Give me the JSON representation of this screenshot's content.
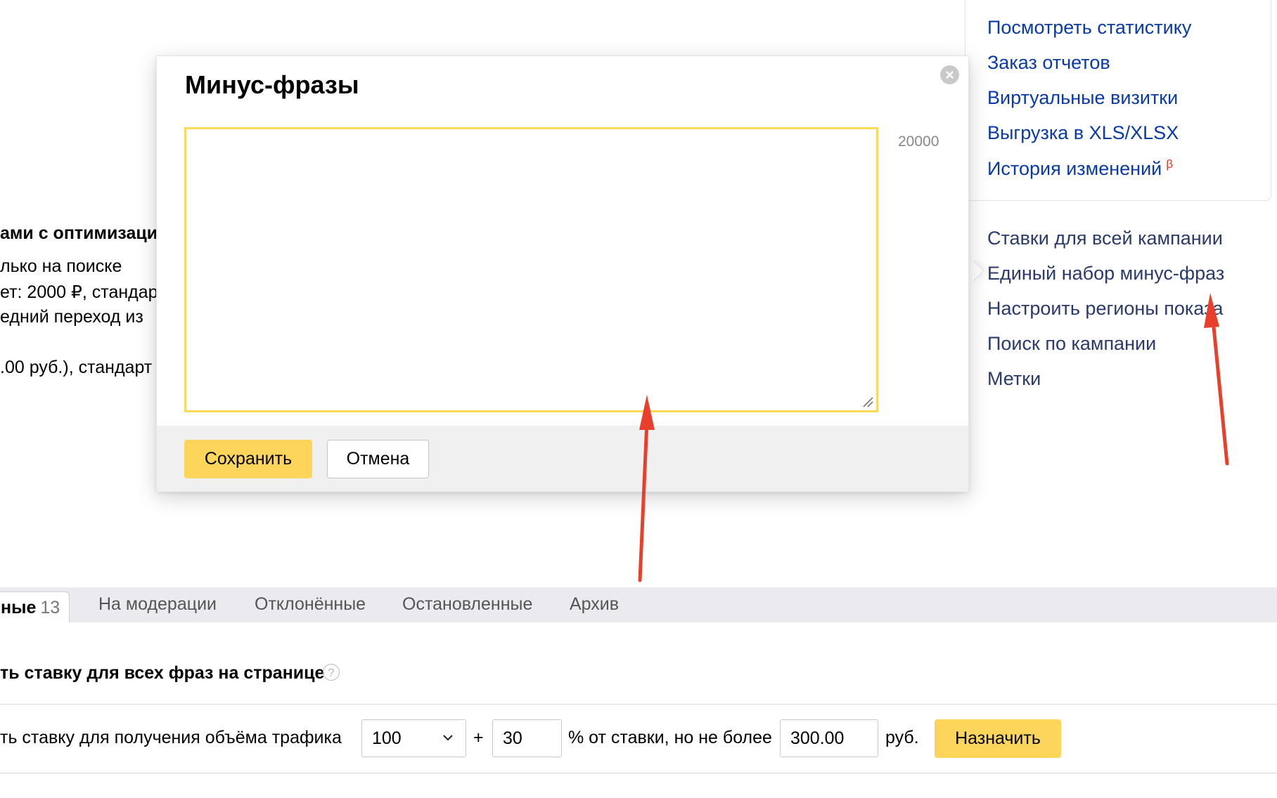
{
  "right_panel": {
    "links": [
      "Посмотреть статистику",
      "Заказ отчетов",
      "Виртуальные визитки",
      "Выгрузка в XLS/XLSX",
      "История изменений"
    ],
    "beta_mark": "β",
    "actions": [
      "Ставки для всей кампании",
      "Единый набор минус-фраз",
      "Настроить регионы показа",
      "Поиск по кампании",
      "Метки"
    ]
  },
  "left_text": {
    "lines": [
      "ами с оптимизаци",
      "лько на поиске",
      "ет: 2000 ₽, стандар",
      "едний переход из",
      ".00 руб.), стандарт"
    ]
  },
  "modal": {
    "title": "Минус-фразы",
    "close_symbol": "×",
    "counter": "20000",
    "textarea_value": "",
    "save_label": "Сохранить",
    "cancel_label": "Отмена"
  },
  "tabs": {
    "active_label": "ные",
    "active_count": "13",
    "items": [
      "На модерации",
      "Отклонённые",
      "Остановленные",
      "Архив"
    ]
  },
  "bids": {
    "title": "ть ставку для всех фраз на странице",
    "help_symbol": "?",
    "row_label": "ть ставку для получения объёма трафика",
    "traffic_select": "100",
    "plus": "+",
    "percent_value": "30",
    "percent_label": "% от ставки, но не более",
    "max_value": "300.00",
    "currency": "руб.",
    "assign_label": "Назначить"
  },
  "colors": {
    "accent_yellow": "#fcd55a",
    "link_blue": "#0a3aa8",
    "arrow_red": "#e8402a"
  }
}
